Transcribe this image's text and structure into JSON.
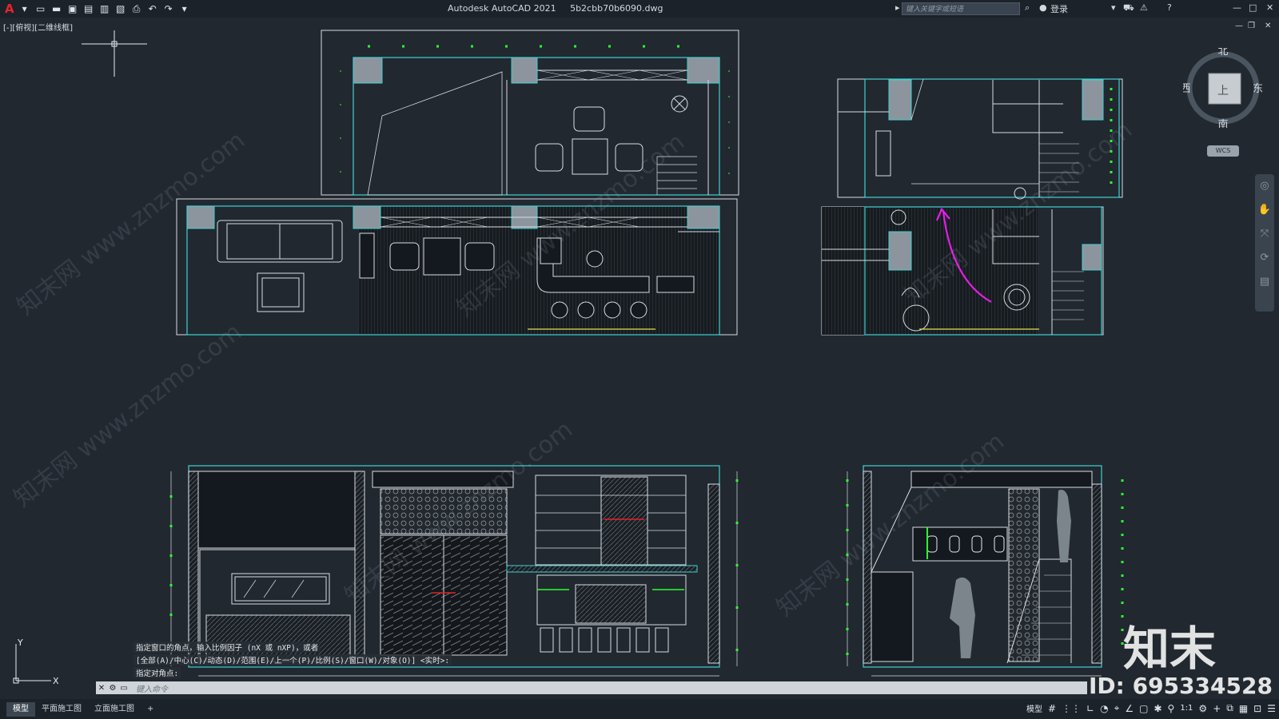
{
  "titlebar": {
    "app_title": "Autodesk AutoCAD 2021",
    "file_name": "5b2cbb70b6090.dwg",
    "search_placeholder": "键入关键字或短语",
    "login_label": "登录"
  },
  "viewport": {
    "view_label": "[-][俯视][二维线框]"
  },
  "viewcube": {
    "north": "北",
    "south": "南",
    "west": "西",
    "east": "东",
    "face": "上",
    "ucs": "WCS"
  },
  "command": {
    "history": [
      "指定窗口的角点，输入比例因子 (nX 或 nXP)，或者",
      "[全部(A)/中心(C)/动态(D)/范围(E)/上一个(P)/比例(S)/窗口(W)/对象(O)] <实时>:",
      "指定对角点:"
    ],
    "placeholder": "键入命令"
  },
  "layout_tabs": [
    "模型",
    "平面施工图",
    "立面施工图"
  ],
  "status": {
    "model_label": "模型",
    "scale": "1:1"
  },
  "watermark": {
    "text": "知末网 www.znzmo.com",
    "brand": "知末",
    "id": "ID: 695334528"
  },
  "colors": {
    "background": "#212830",
    "cyan": "#3fd1d1",
    "green": "#2bff2b",
    "magenta": "#e51ee5",
    "white_line": "#d9dde2"
  }
}
